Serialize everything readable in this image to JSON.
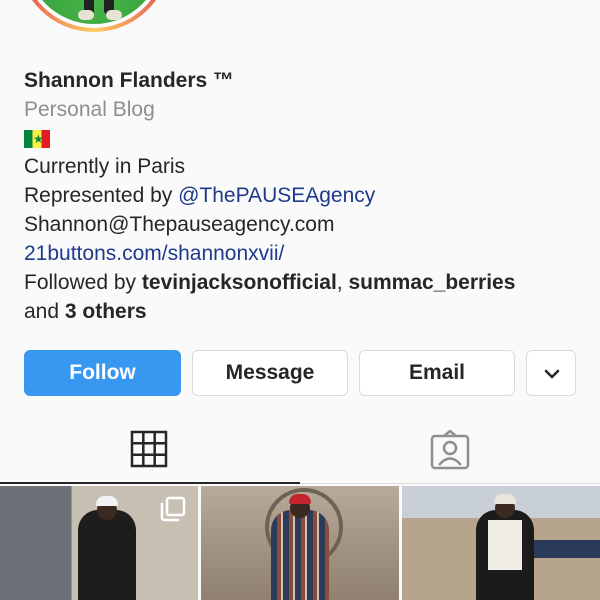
{
  "profile": {
    "name": "Shannon Flanders ™",
    "category": "Personal Blog",
    "bio": {
      "line1": "Currently in Paris",
      "represented_prefix": "Represented by ",
      "represented_link": "@ThePAUSEAgency",
      "email_text": "Shannon@Thepauseagency.com",
      "website": "21buttons.com/shannonxvii/"
    },
    "followed_by": {
      "prefix": "Followed by ",
      "user1": "tevinjacksonofficial",
      "separator": ", ",
      "user2": "summac_berries",
      "and_text": "and ",
      "others": "3 others"
    }
  },
  "actions": {
    "follow": "Follow",
    "message": "Message",
    "email": "Email"
  },
  "icons": {
    "flag": "senegal-flag-icon",
    "more": "chevron-down-icon",
    "grid_tab": "grid-icon",
    "tagged_tab": "tagged-person-icon",
    "multi_photo": "multiple-photos-icon"
  },
  "colors": {
    "follow_button": "#3897f0",
    "link": "#1e3a8a",
    "secondary_text": "#8e8e8e"
  }
}
